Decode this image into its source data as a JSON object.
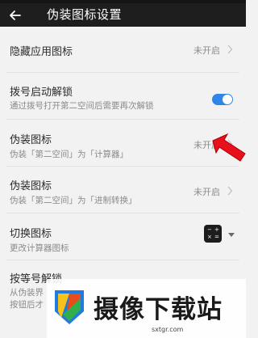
{
  "header": {
    "title": "伪装图标设置"
  },
  "rows": [
    {
      "title": "隐藏应用图标",
      "value": "未开启"
    },
    {
      "title": "拨号启动解锁",
      "subtitle": "通过拨号打开第二空间后需要再次解锁",
      "toggle_on": true
    },
    {
      "title": "伪装图标",
      "subtitle": "伪装「第二空间」为「计算器」",
      "value": "未开启"
    },
    {
      "title": "伪装图标",
      "subtitle": "伪装「第二空间」为「进制转换」",
      "value": "未开启"
    },
    {
      "title": "切换图标",
      "subtitle": "更改计算器图标"
    },
    {
      "title": "按等号解锁",
      "subtitle": "从伪装界",
      "subtitle2": "按钮后才"
    }
  ],
  "watermark": {
    "text": "摄像下载站",
    "url": "sxtgr.com"
  },
  "colors": {
    "accent": "#2f85e8",
    "topbar": "#1e1e1e",
    "arrow": "#e8101a"
  }
}
